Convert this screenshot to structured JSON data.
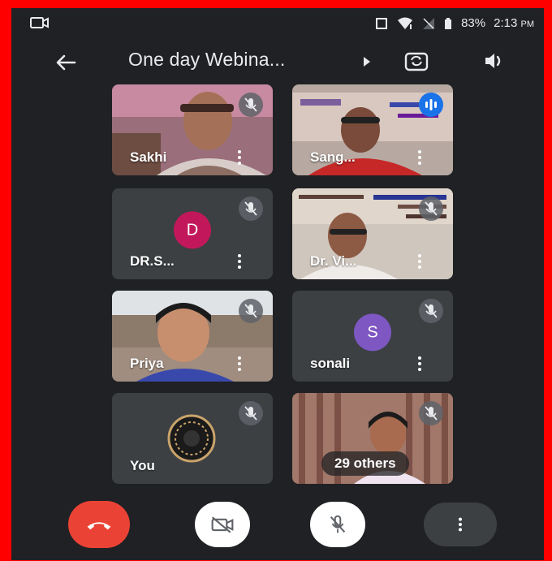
{
  "status_bar": {
    "battery": "83%",
    "time": "2:13",
    "ampm": "PM"
  },
  "header": {
    "title": "One day Webina..."
  },
  "participants": [
    {
      "name": "Sakhi",
      "state": "muted",
      "type": "video"
    },
    {
      "name": "Sang...",
      "state": "speaking",
      "type": "video"
    },
    {
      "name": "DR.S...",
      "state": "muted",
      "type": "avatar",
      "initial": "D",
      "avatar_color": "#c2185b"
    },
    {
      "name": "Dr. Vi...",
      "state": "muted",
      "type": "video"
    },
    {
      "name": "Priya",
      "state": "muted",
      "type": "video"
    },
    {
      "name": "sonali",
      "state": "muted",
      "type": "avatar",
      "initial": "S",
      "avatar_color": "#7e57c2"
    },
    {
      "name": "You",
      "state": "muted",
      "type": "avatar-image"
    },
    {
      "name": "29 others",
      "state": "muted",
      "type": "video-others"
    }
  ],
  "controls": {
    "end_call": "end-call-icon",
    "camera": "camera-off-icon",
    "mic": "mic-off-icon",
    "more": "more-vert-icon"
  },
  "colors": {
    "background": "#202124",
    "tile": "#3c4043",
    "end_call": "#ea4335",
    "speaking": "#1a73e8",
    "frame": "#ff0000"
  }
}
